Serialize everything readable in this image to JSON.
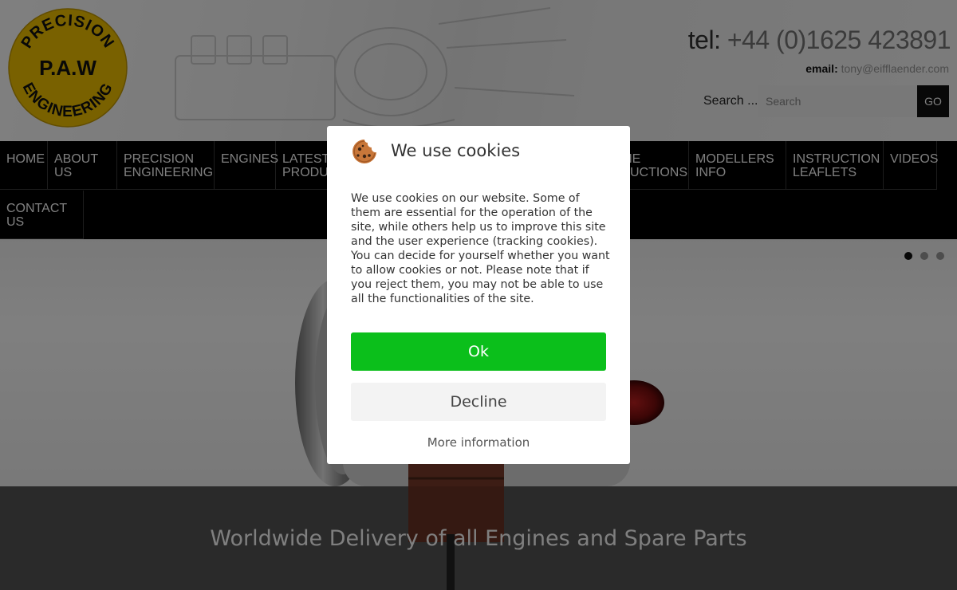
{
  "logo": {
    "top_text": "PRECISION",
    "center_text": "P.A.W",
    "bottom_text": "ENGINEERING"
  },
  "contact": {
    "phone_label": "tel:",
    "phone_value": "+44 (0)1625 423891",
    "email_label": "email:",
    "email_value": "tony@eifflaender.com"
  },
  "search": {
    "label": "Search ...",
    "placeholder": "Search",
    "button": "GO"
  },
  "nav": {
    "items": [
      {
        "label": "HOME"
      },
      {
        "label": "ABOUT US"
      },
      {
        "label": "PRECISION\nENGINEERING"
      },
      {
        "label": "ENGINES"
      },
      {
        "label": "LATEST\nPRODUCTS"
      },
      {
        "label": "ENGINE\nINSTRUCTIONS"
      },
      {
        "label": "MODELLERS\nINFO"
      },
      {
        "label": "INSTRUCTION\nLEAFLETS"
      },
      {
        "label": "VIDEOS"
      },
      {
        "label": "CONTACT US"
      }
    ]
  },
  "hero": {
    "slides_total": 3,
    "active_slide": 1,
    "banner": "Worldwide Delivery of all Engines and Spare Parts"
  },
  "cookie_modal": {
    "title": "We use cookies",
    "body": "We use cookies on our website. Some of them are essential for the operation of the site, while others help us to improve this site and the user experience (tracking cookies). You can decide for yourself whether you want to allow cookies or not. Please note that if you reject them, you may not be able to use all the functionalities of the site.",
    "ok_label": "Ok",
    "decline_label": "Decline",
    "more_info_label": "More information"
  },
  "colors": {
    "logo_gold": "#f2c200",
    "ok_green": "#0bbf1b",
    "nav_bg": "#000000",
    "cookie_brown": "#c8773a"
  }
}
